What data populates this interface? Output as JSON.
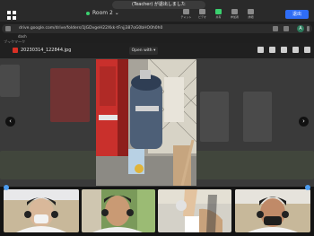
{
  "meeting": {
    "notice": "(Teacher) が退出しました",
    "room_name": "Room 2",
    "left_caption": "ブックマーク",
    "toolbar": [
      {
        "label": "チャット",
        "icon": "chat-icon",
        "active": false
      },
      {
        "label": "ビデオ",
        "icon": "video-icon",
        "active": false
      },
      {
        "label": "共有",
        "icon": "share-icon",
        "active": true
      },
      {
        "label": "参加者",
        "icon": "participants-icon",
        "active": false
      },
      {
        "label": "詳細",
        "icon": "more-icon",
        "active": false
      }
    ],
    "leave_label": "退出"
  },
  "browser": {
    "url": "drive.google.com/drive/folders/1JGDvgeH22Xkk-tFnjj387oG0bHO0h0h0",
    "tab_label": "dash",
    "profile_initial": "A"
  },
  "viewer": {
    "file_name": "20230314_122844.jpg",
    "open_with_label": "Open with",
    "prev_icon": "chevron-left-icon",
    "next_icon": "chevron-right-icon"
  },
  "colors": {
    "accent": "#2f6df5",
    "active": "#3bd16f",
    "background": "#1b1b1b"
  }
}
